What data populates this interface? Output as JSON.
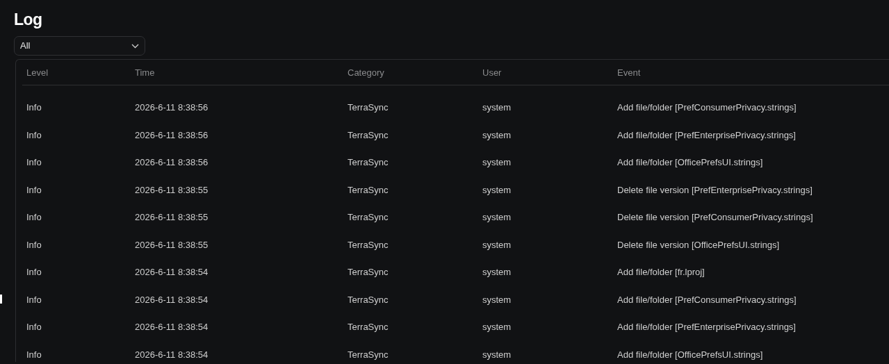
{
  "title": "Log",
  "filter": {
    "value": "All"
  },
  "table": {
    "columns": [
      "Level",
      "Time",
      "Category",
      "User",
      "Event"
    ],
    "rows": [
      [
        "Info",
        "2026-6-11 8:38:56",
        "TerraSync",
        "system",
        "Add file/folder [PrefConsumerPrivacy.strings]"
      ],
      [
        "Info",
        "2026-6-11 8:38:56",
        "TerraSync",
        "system",
        "Add file/folder [PrefEnterprisePrivacy.strings]"
      ],
      [
        "Info",
        "2026-6-11 8:38:56",
        "TerraSync",
        "system",
        "Add file/folder [OfficePrefsUI.strings]"
      ],
      [
        "Info",
        "2026-6-11 8:38:55",
        "TerraSync",
        "system",
        "Delete file version [PrefEnterprisePrivacy.strings]"
      ],
      [
        "Info",
        "2026-6-11 8:38:55",
        "TerraSync",
        "system",
        "Delete file version [PrefConsumerPrivacy.strings]"
      ],
      [
        "Info",
        "2026-6-11 8:38:55",
        "TerraSync",
        "system",
        "Delete file version [OfficePrefsUI.strings]"
      ],
      [
        "Info",
        "2026-6-11 8:38:54",
        "TerraSync",
        "system",
        "Add file/folder [fr.lproj]"
      ],
      [
        "Info",
        "2026-6-11 8:38:54",
        "TerraSync",
        "system",
        "Add file/folder [PrefConsumerPrivacy.strings]"
      ],
      [
        "Info",
        "2026-6-11 8:38:54",
        "TerraSync",
        "system",
        "Add file/folder [PrefEnterprisePrivacy.strings]"
      ],
      [
        "Info",
        "2026-6-11 8:38:54",
        "TerraSync",
        "system",
        "Add file/folder [OfficePrefsUI.strings]"
      ]
    ]
  }
}
